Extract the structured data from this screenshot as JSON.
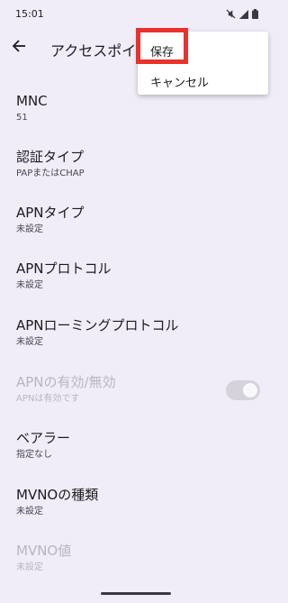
{
  "status_bar": {
    "time": "15:01",
    "icons": [
      "mute-icon",
      "signal-icon",
      "battery-icon"
    ]
  },
  "app_bar": {
    "title": "アクセスポイン",
    "back_icon": "back-arrow-icon"
  },
  "menu": {
    "save_label": "保存",
    "cancel_label": "キャンセル",
    "highlight_color": "#e8322b"
  },
  "settings": [
    {
      "title": "MNC",
      "summary": "51"
    },
    {
      "title": "認証タイプ",
      "summary": "PAPまたはCHAP"
    },
    {
      "title": "APNタイプ",
      "summary": "未設定"
    },
    {
      "title": "APNプロトコル",
      "summary": "未設定"
    },
    {
      "title": "APNローミングプロトコル",
      "summary": "未設定"
    },
    {
      "title": "APNの有効/無効",
      "summary": "APNは有効です"
    },
    {
      "title": "ベアラー",
      "summary": "指定なし"
    },
    {
      "title": "MVNOの種類",
      "summary": "未設定"
    },
    {
      "title": "MVNO値",
      "summary": "未設定"
    }
  ],
  "apn_enabled_toggle": true,
  "colors": {
    "background": "#f1edf8",
    "menu_background": "#ffffff",
    "disabled_text": "#b8b5c0"
  }
}
